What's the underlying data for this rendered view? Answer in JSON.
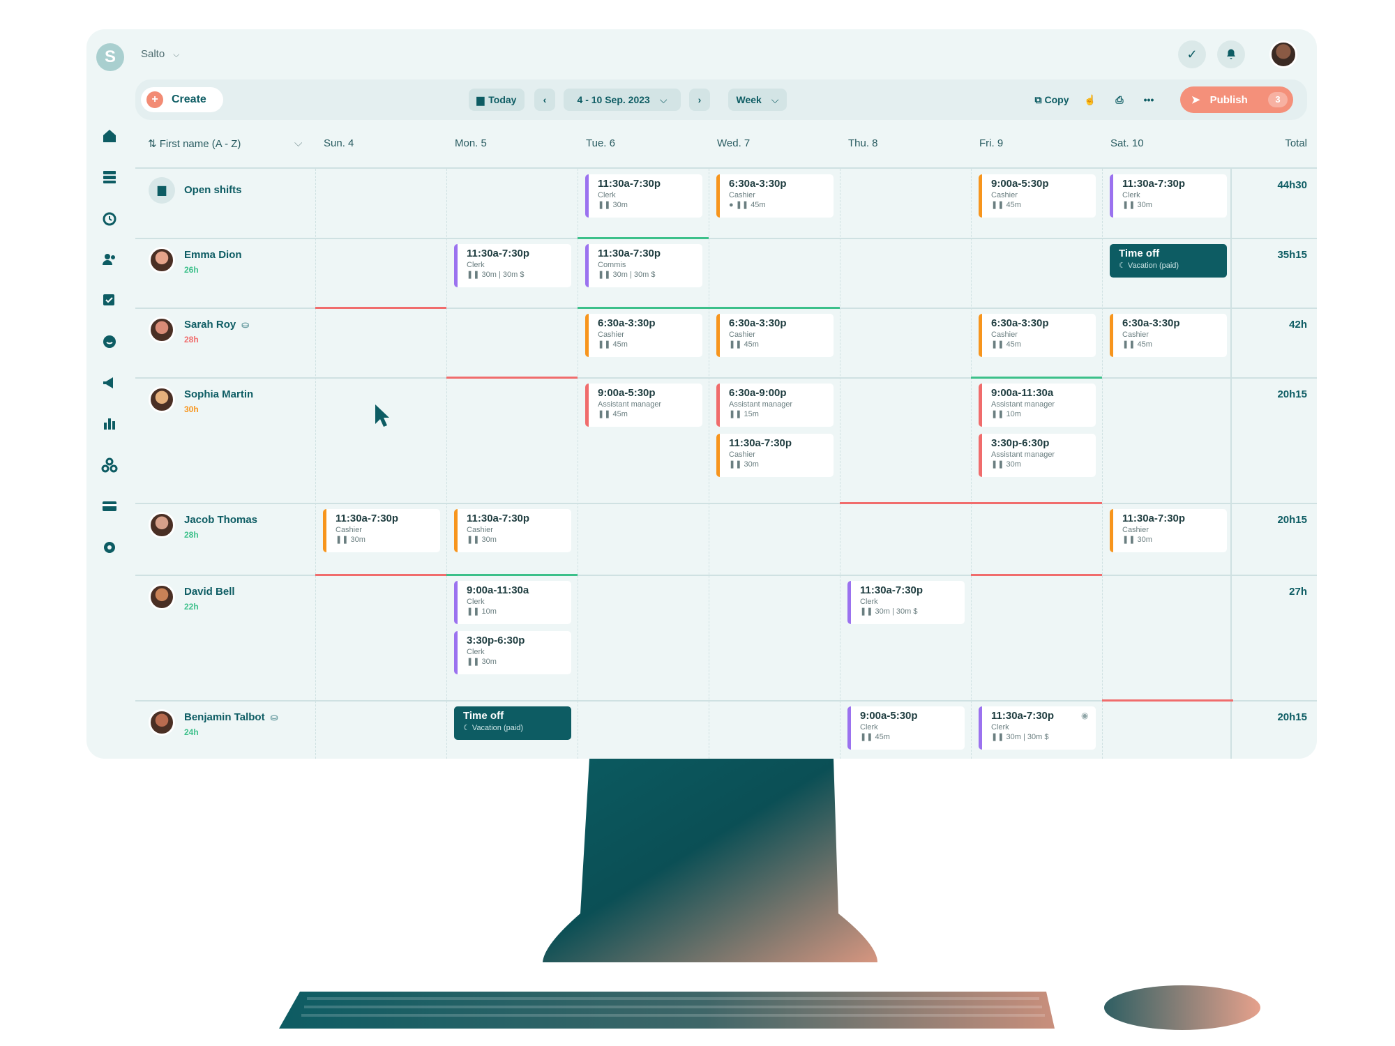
{
  "header": {
    "logo_letter": "S",
    "org_name": "Salto"
  },
  "toolbar": {
    "create_label": "Create",
    "today_label": "Today",
    "date_range": "4 - 10 Sep. 2023",
    "view_label": "Week",
    "copy_label": "Copy",
    "publish_label": "Publish",
    "publish_count": "3"
  },
  "grid": {
    "sort_label": "First name (A - Z)",
    "days": [
      "Sun. 4",
      "Mon. 5",
      "Tue. 6",
      "Wed. 7",
      "Thu. 8",
      "Fri. 9",
      "Sat. 10"
    ],
    "total_label": "Total"
  },
  "colors": {
    "brand": "#0d5c63",
    "accent": "#f4907a",
    "role_clerk": "#9b72ef",
    "role_cashier": "#f7951d",
    "role_assistant_manager": "#f06c6c",
    "over_hours": "#f06c6c",
    "under_hours": "#3cc08a"
  },
  "rows": [
    {
      "name": "Open shifts",
      "hours": "",
      "total": "44h30",
      "shifts": [
        {
          "day": 2,
          "time": "11:30a-7:30p",
          "role": "Clerk",
          "brk": "❚❚ 30m",
          "color": "#9b72ef"
        },
        {
          "day": 3,
          "time": "6:30a-3:30p",
          "role": "Cashier",
          "brk": "● ❚❚ 45m",
          "color": "#f7951d"
        },
        {
          "day": 5,
          "time": "9:00a-5:30p",
          "role": "Cashier",
          "brk": "❚❚ 45m",
          "color": "#f7951d"
        },
        {
          "day": 6,
          "time": "11:30a-7:30p",
          "role": "Clerk",
          "brk": "❚❚ 30m",
          "color": "#9b72ef"
        }
      ]
    },
    {
      "name": "Emma Dion",
      "hours": "26h",
      "total": "35h15",
      "shifts": [
        {
          "day": 1,
          "time": "11:30a-7:30p",
          "role": "Clerk",
          "brk": "❚❚ 30m  |  30m $",
          "color": "#9b72ef"
        },
        {
          "day": 2,
          "time": "11:30a-7:30p",
          "role": "Commis",
          "brk": "❚❚ 30m  |  30m $",
          "color": "#9b72ef"
        }
      ],
      "timeoff": [
        {
          "day": 6,
          "title": "Time off",
          "sub": "☾ Vacation (paid)"
        }
      ]
    },
    {
      "name": "Sarah Roy",
      "hours": "28h",
      "total": "42h",
      "shifts": [
        {
          "day": 2,
          "time": "6:30a-3:30p",
          "role": "Cashier",
          "brk": "❚❚ 45m",
          "color": "#f7951d"
        },
        {
          "day": 3,
          "time": "6:30a-3:30p",
          "role": "Cashier",
          "brk": "❚❚ 45m",
          "color": "#f7951d"
        },
        {
          "day": 5,
          "time": "6:30a-3:30p",
          "role": "Cashier",
          "brk": "❚❚ 45m",
          "color": "#f7951d"
        },
        {
          "day": 6,
          "time": "6:30a-3:30p",
          "role": "Cashier",
          "brk": "❚❚ 45m",
          "color": "#f7951d"
        }
      ]
    },
    {
      "name": "Sophia Martin",
      "hours": "30h",
      "total": "20h15",
      "shifts": [
        {
          "day": 2,
          "time": "9:00a-5:30p",
          "role": "Assistant manager",
          "brk": "❚❚ 45m",
          "color": "#f06c6c"
        },
        {
          "day": 3,
          "time": "6:30a-9:00p",
          "role": "Assistant manager",
          "brk": "❚❚ 15m",
          "color": "#f06c6c"
        },
        {
          "day": 3,
          "time": "11:30a-7:30p",
          "role": "Cashier",
          "brk": "❚❚ 30m",
          "color": "#f7951d",
          "slot": 1
        },
        {
          "day": 5,
          "time": "9:00a-11:30a",
          "role": "Assistant manager",
          "brk": "❚❚ 10m",
          "color": "#f06c6c"
        },
        {
          "day": 5,
          "time": "3:30p-6:30p",
          "role": "Assistant manager",
          "brk": "❚❚ 30m",
          "color": "#f06c6c",
          "slot": 1
        }
      ]
    },
    {
      "name": "Jacob Thomas",
      "hours": "28h",
      "total": "20h15",
      "shifts": [
        {
          "day": 0,
          "time": "11:30a-7:30p",
          "role": "Cashier",
          "brk": "❚❚ 30m",
          "color": "#f7951d"
        },
        {
          "day": 1,
          "time": "11:30a-7:30p",
          "role": "Cashier",
          "brk": "❚❚ 30m",
          "color": "#f7951d"
        },
        {
          "day": 6,
          "time": "11:30a-7:30p",
          "role": "Cashier",
          "brk": "❚❚ 30m",
          "color": "#f7951d"
        }
      ]
    },
    {
      "name": "David Bell",
      "hours": "22h",
      "total": "27h",
      "shifts": [
        {
          "day": 1,
          "time": "9:00a-11:30a",
          "role": "Clerk",
          "brk": "❚❚ 10m",
          "color": "#9b72ef"
        },
        {
          "day": 1,
          "time": "3:30p-6:30p",
          "role": "Clerk",
          "brk": "❚❚ 30m",
          "color": "#9b72ef",
          "slot": 1
        },
        {
          "day": 4,
          "time": "11:30a-7:30p",
          "role": "Clerk",
          "brk": "❚❚ 30m  |  30m $",
          "color": "#9b72ef"
        }
      ]
    },
    {
      "name": "Benjamin Talbot",
      "hours": "24h",
      "total": "20h15",
      "shifts": [
        {
          "day": 4,
          "time": "9:00a-5:30p",
          "role": "Clerk",
          "brk": "❚❚ 45m",
          "color": "#9b72ef"
        },
        {
          "day": 5,
          "time": "11:30a-7:30p",
          "role": "Clerk",
          "brk": "❚❚ 30m  |  30m $",
          "color": "#9b72ef"
        }
      ],
      "timeoff": [
        {
          "day": 1,
          "title": "Time off",
          "sub": "☾ Vacation (paid)"
        }
      ]
    }
  ]
}
